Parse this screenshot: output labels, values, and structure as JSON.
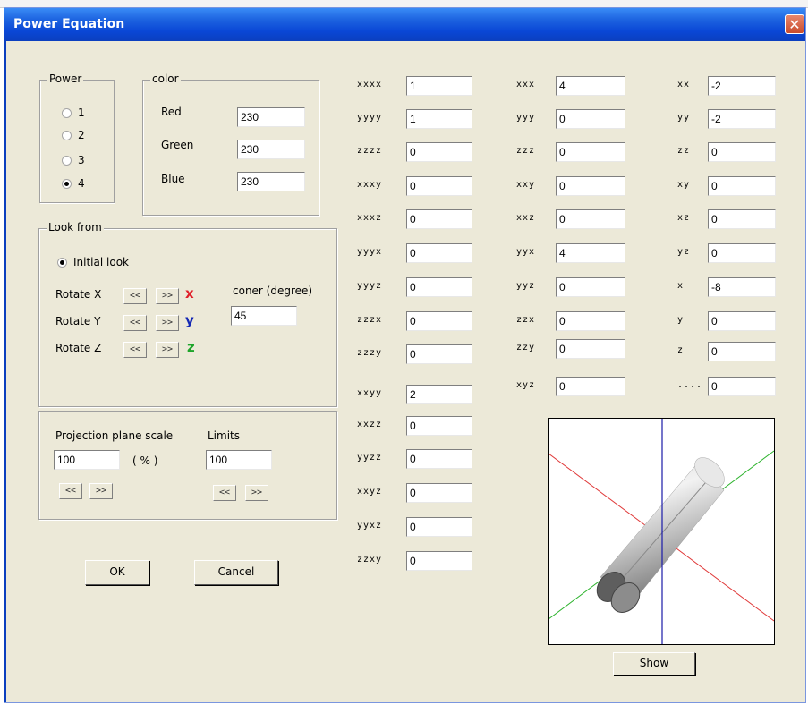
{
  "window": {
    "title": "Power Equation",
    "close_glyph": "✕"
  },
  "power": {
    "legend": "Power",
    "options": [
      "1",
      "2",
      "3",
      "4"
    ],
    "selected": "4"
  },
  "color": {
    "legend": "color",
    "red_label": "Red",
    "red": "230",
    "green_label": "Green",
    "green": "230",
    "blue_label": "Blue",
    "blue": "230"
  },
  "look_from": {
    "legend": "Look from",
    "initial_look": "Initial look",
    "rotate_x": "Rotate X",
    "rotate_y": "Rotate Y",
    "rotate_z": "Rotate Z",
    "left_btn": "<<",
    "right_btn": ">>",
    "axis_x": "x",
    "axis_y": "y",
    "axis_z": "z",
    "corner_label": "coner (degree)",
    "corner_value": "45"
  },
  "projection": {
    "scale_label": "Projection plane scale",
    "scale_value": "100",
    "percent": "( % )",
    "limits_label": "Limits",
    "limits_value": "100",
    "left_btn": "<<",
    "right_btn": ">>"
  },
  "buttons": {
    "ok": "OK",
    "cancel": "Cancel",
    "show": "Show"
  },
  "coefficients": {
    "col1": [
      {
        "term": "xxxx",
        "value": "1"
      },
      {
        "term": "yyyy",
        "value": "1"
      },
      {
        "term": "zzzz",
        "value": "0"
      },
      {
        "term": "xxxy",
        "value": "0"
      },
      {
        "term": "xxxz",
        "value": "0"
      },
      {
        "term": "yyyx",
        "value": "0"
      },
      {
        "term": "yyyz",
        "value": "0"
      },
      {
        "term": "zzzx",
        "value": "0"
      },
      {
        "term": "zzzy",
        "value": "0"
      },
      {
        "term": "xxyy",
        "value": "2"
      },
      {
        "term": "xxzz",
        "value": "0"
      },
      {
        "term": "yyzz",
        "value": "0"
      },
      {
        "term": "xxyz",
        "value": "0"
      },
      {
        "term": "yyxz",
        "value": "0"
      },
      {
        "term": "zzxy",
        "value": "0"
      }
    ],
    "col2": [
      {
        "term": "xxx",
        "value": "4"
      },
      {
        "term": "yyy",
        "value": "0"
      },
      {
        "term": "zzz",
        "value": "0"
      },
      {
        "term": "xxy",
        "value": "0"
      },
      {
        "term": "xxz",
        "value": "0"
      },
      {
        "term": "yyx",
        "value": "4"
      },
      {
        "term": "yyz",
        "value": "0"
      },
      {
        "term": "zzx",
        "value": "0"
      },
      {
        "term": "zzy",
        "value": "0"
      },
      {
        "term": "xyz",
        "value": "0"
      }
    ],
    "col3": [
      {
        "term": "xx",
        "value": "-2"
      },
      {
        "term": "yy",
        "value": "-2"
      },
      {
        "term": "zz",
        "value": "0"
      },
      {
        "term": "xy",
        "value": "0"
      },
      {
        "term": "xz",
        "value": "0"
      },
      {
        "term": "yz",
        "value": "0"
      },
      {
        "term": "x",
        "value": "-8"
      },
      {
        "term": "y",
        "value": "0"
      },
      {
        "term": "z",
        "value": "0"
      },
      {
        "term": "....",
        "value": "0"
      }
    ]
  },
  "colors": {
    "axis_x": "#e0202a",
    "axis_y": "#1428b4",
    "axis_z": "#1ea52a",
    "title_bar": "#0a47d6"
  }
}
